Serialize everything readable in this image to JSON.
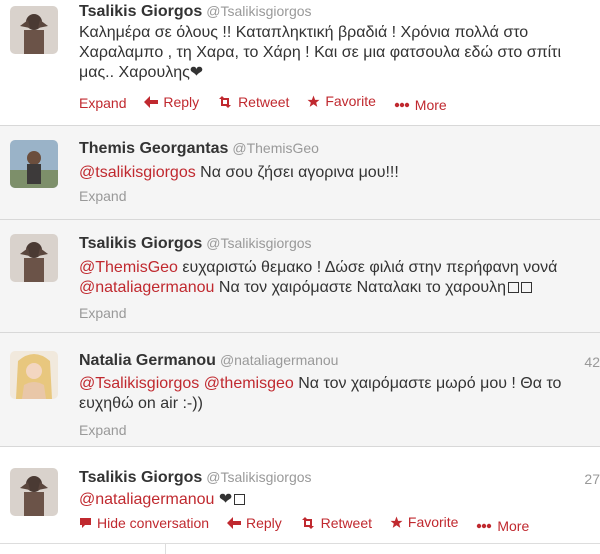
{
  "tweets": [
    {
      "name": "Tsalikis Giorgos",
      "handle": "@Tsalikisgiorgos",
      "time": "",
      "avatar": "man-shirtless-avatar",
      "lines": [
        [
          {
            "t": "Καλημέρα σε όλους !! Καταπληκτική βραδιά ! Χρόνια πολλά στο"
          }
        ],
        [
          {
            "t": "Χαραλαμπο , τη Χαρα, το Χάρη ! Και σε μια φατσουλα εδώ στο σπίτι"
          }
        ],
        [
          {
            "t": "μας.. Χαρουλης"
          },
          {
            "t": "❤",
            "heart": true
          }
        ]
      ],
      "actions": {
        "expand": "Expand",
        "reply": "Reply",
        "retweet": "Retweet",
        "favorite": "Favorite",
        "more": "More"
      }
    },
    {
      "name": "Themis Georgantas",
      "handle": "@ThemisGeo",
      "time": "",
      "avatar": "man-outdoor-avatar",
      "lines": [
        [
          {
            "t": "@tsalikisgiorgos",
            "m": true
          },
          {
            "t": " Να σου ζήσει αγορινα μου!!!"
          }
        ]
      ],
      "expand": "Expand"
    },
    {
      "name": "Tsalikis Giorgos",
      "handle": "@Tsalikisgiorgos",
      "time": "",
      "avatar": "man-shirtless-avatar",
      "lines": [
        [
          {
            "t": "@ThemisGeo",
            "m": true
          },
          {
            "t": " ευχαριστώ θεμακο ! Δώσε φιλιά στην περήφανη νονά"
          }
        ],
        [
          {
            "t": "@nataliagermanou",
            "m": true
          },
          {
            "t": " Να τον χαιρόμαστε Ναταλακι το χαρουλη"
          },
          {
            "t": "",
            "box": 2
          }
        ]
      ],
      "expand": "Expand"
    },
    {
      "name": "Natalia Germanou",
      "handle": "@nataliagermanou",
      "time": "42",
      "avatar": "woman-blonde-avatar",
      "lines": [
        [
          {
            "t": "@Tsalikisgiorgos",
            "m": true
          },
          {
            "t": " "
          },
          {
            "t": "@themisgeo",
            "m": true
          },
          {
            "t": " Να τον χαιρόμαστε μωρό μου ! Θα το"
          }
        ],
        [
          {
            "t": "ευχηθώ on air :-))"
          }
        ]
      ],
      "expand": "Expand"
    },
    {
      "name": "Tsalikis Giorgos",
      "handle": "@Tsalikisgiorgos",
      "time": "27",
      "avatar": "man-shirtless-avatar",
      "lines": [
        [
          {
            "t": "@nataliagermanou",
            "m": true
          },
          {
            "t": " "
          },
          {
            "t": "❤",
            "heart": true
          },
          {
            "t": "",
            "box": 1
          }
        ]
      ],
      "actions": {
        "hide": "Hide conversation",
        "reply": "Reply",
        "retweet": "Retweet",
        "favorite": "Favorite",
        "more": "More"
      }
    }
  ],
  "colors": {
    "accent": "#c0292f",
    "muted": "#999999",
    "text": "#333333"
  }
}
